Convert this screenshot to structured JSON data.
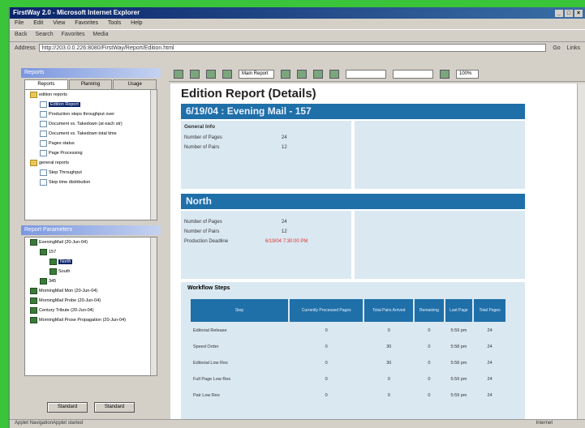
{
  "window": {
    "title": "FirstWay 2.0 - Microsoft Internet Explorer"
  },
  "menu": [
    "File",
    "Edit",
    "View",
    "Favorites",
    "Tools",
    "Help"
  ],
  "toolbar": {
    "back": "Back",
    "search": "Search",
    "favorites": "Favorites",
    "media": "Media"
  },
  "address": {
    "label": "Address",
    "value": "http://203.0.0.226:8080/FirstWay/Report/Edition.html",
    "go": "Go",
    "links": "Links"
  },
  "left_panel": {
    "header": "Reports",
    "tabs": [
      "Reports",
      "Planning",
      "Usage"
    ],
    "tree": [
      {
        "label": "edition reports",
        "type": "folder",
        "indent": 0
      },
      {
        "label": "Edition Report",
        "type": "doc",
        "indent": 1,
        "selected": true
      },
      {
        "label": "Production steps throughput over",
        "type": "doc",
        "indent": 1
      },
      {
        "label": "Document vs. Takedown (at each str)",
        "type": "doc",
        "indent": 1
      },
      {
        "label": "Document vs. Takedown total time",
        "type": "doc",
        "indent": 1
      },
      {
        "label": "Pages status",
        "type": "doc",
        "indent": 1
      },
      {
        "label": "Page Processing",
        "type": "doc",
        "indent": 1
      },
      {
        "label": "general reports",
        "type": "folder",
        "indent": 0
      },
      {
        "label": "Step Throughput",
        "type": "doc",
        "indent": 1
      },
      {
        "label": "Step time distribution",
        "type": "doc",
        "indent": 1
      }
    ],
    "params_header": "Report Parameters",
    "params_tree": [
      {
        "label": "EveningMail (20-Jun-04)",
        "type": "db",
        "indent": 0
      },
      {
        "label": "157",
        "type": "db",
        "indent": 1
      },
      {
        "label": "North",
        "type": "db",
        "indent": 2,
        "selected": true
      },
      {
        "label": "South",
        "type": "db",
        "indent": 2
      },
      {
        "label": "345",
        "type": "db",
        "indent": 1
      },
      {
        "label": "MorningMail Mon (20-Jun-04)",
        "type": "db",
        "indent": 0
      },
      {
        "label": "MorningMail Probe (20-Jun-04)",
        "type": "db",
        "indent": 0
      },
      {
        "label": "Century Tribute (20-Jun-04)",
        "type": "db",
        "indent": 0
      },
      {
        "label": "MorningMail Prose Propagation (20-Jun-04)",
        "type": "db",
        "indent": 0
      }
    ],
    "buttons": [
      "Standard",
      "Standard"
    ]
  },
  "report_toolbar": {
    "view_select": "Main Report",
    "zoom": "100%"
  },
  "report": {
    "title": "Edition Report (Details)",
    "edition_bar": "6/19/04 : Evening Mail - 157",
    "general_info": {
      "title": "General Info",
      "rows": [
        {
          "key": "Number of Pages",
          "value": "24"
        },
        {
          "key": "Number of Pairs",
          "value": "12"
        }
      ]
    },
    "zone_bar": "North",
    "zone_info": {
      "rows": [
        {
          "key": "Number of Pages",
          "value": "24"
        },
        {
          "key": "Number of Pairs",
          "value": "12"
        },
        {
          "key": "Production Deadline",
          "value": "6/19/04 7:30:00 PM",
          "red": true
        }
      ]
    },
    "workflow": {
      "title": "Workflow Steps",
      "headers": [
        "Step",
        "Currently Processed Pages",
        "Total Pairs Arrived",
        "Remaining",
        "Last Page",
        "Total Pages"
      ],
      "rows": [
        [
          "Editorial Release",
          "0",
          "0",
          "0",
          "5:59 pm",
          "24"
        ],
        [
          "Speed Order",
          "0",
          "30",
          "0",
          "5:58 pm",
          "24"
        ],
        [
          "Editorial Low Res",
          "0",
          "30",
          "0",
          "5:58 pm",
          "24"
        ],
        [
          "Full Page Low Res",
          "0",
          "0",
          "0",
          "5:59 pm",
          "24"
        ],
        [
          "Pair Low Res",
          "0",
          "0",
          "0",
          "5:59 pm",
          "24"
        ]
      ]
    }
  },
  "status": {
    "left": "Applet NavigationApplet started",
    "right": "Internet"
  },
  "colors": {
    "accent": "#1f6fa8",
    "panel": "#dae8f1",
    "deadline": "#d33333",
    "frame": "#39c43a"
  }
}
